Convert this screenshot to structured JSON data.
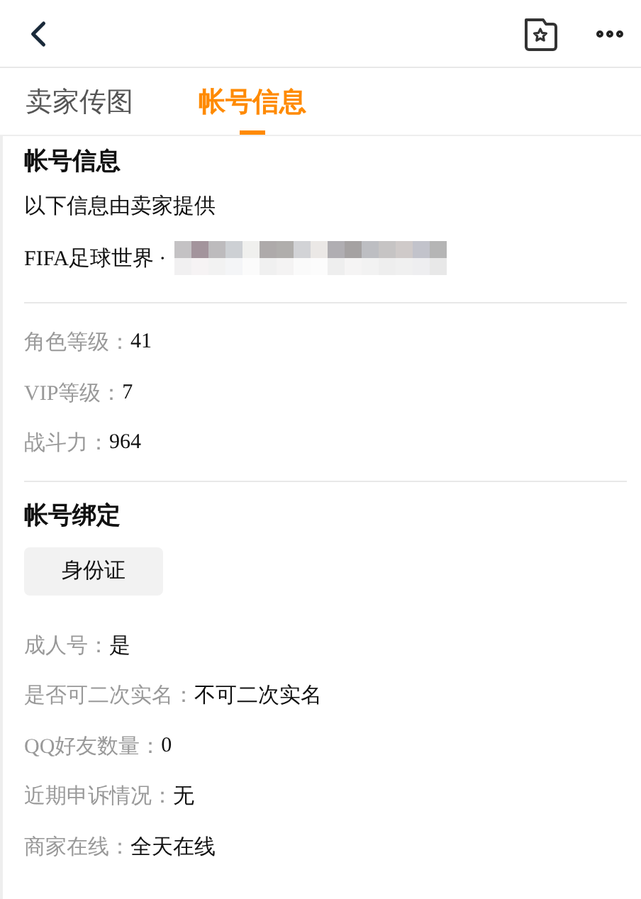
{
  "tabs": [
    {
      "label": "卖家传图",
      "selected": false
    },
    {
      "label": "帐号信息",
      "selected": true
    }
  ],
  "account_info": {
    "title": "帐号信息",
    "note": "以下信息由卖家提供",
    "game": "FIFA足球世界 ·"
  },
  "stats": [
    {
      "label": "角色等级：",
      "value": "41"
    },
    {
      "label": "VIP等级：",
      "value": "7"
    },
    {
      "label": "战斗力：",
      "value": "964"
    }
  ],
  "binding": {
    "title": "帐号绑定",
    "tags": [
      "身份证"
    ]
  },
  "details": [
    {
      "label": "成人号：",
      "value": "是"
    },
    {
      "label": "是否可二次实名：",
      "value": "不可二次实名"
    },
    {
      "label": "QQ好友数量：",
      "value": "0"
    },
    {
      "label": "近期申诉情况：",
      "value": "无"
    },
    {
      "label": "商家在线：",
      "value": "全天在线"
    }
  ]
}
